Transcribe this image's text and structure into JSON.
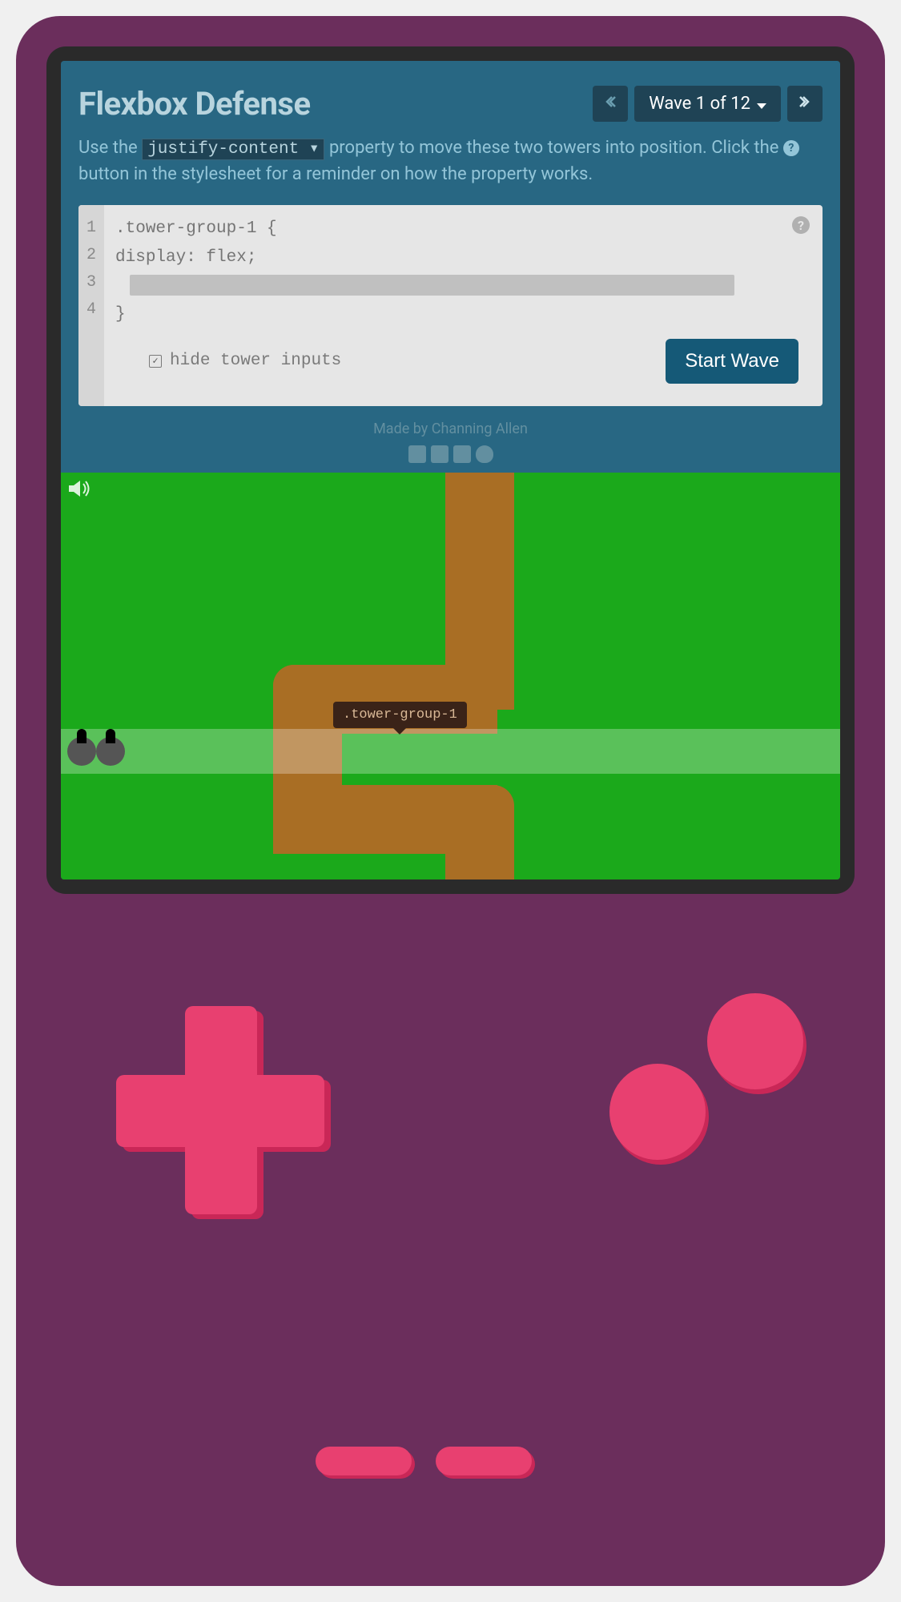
{
  "header": {
    "title": "Flexbox Defense",
    "wave_label": "Wave 1 of 12"
  },
  "instructions": {
    "part1": "Use the ",
    "property": "justify-content ▾",
    "part2": " property to move these two towers into position. Click the ",
    "part3": " button in the stylesheet for a reminder on how the property works."
  },
  "editor": {
    "line_numbers": [
      "1",
      "2",
      "3",
      "4"
    ],
    "line1": ".tower-group-1 {",
    "line2": "  display: flex;",
    "line4": "}",
    "hide_label": "hide tower inputs",
    "hide_checked": true,
    "start_wave": "Start Wave"
  },
  "credits": {
    "text": "Made by Channing Allen"
  },
  "board": {
    "tooltip": ".tower-group-1"
  }
}
